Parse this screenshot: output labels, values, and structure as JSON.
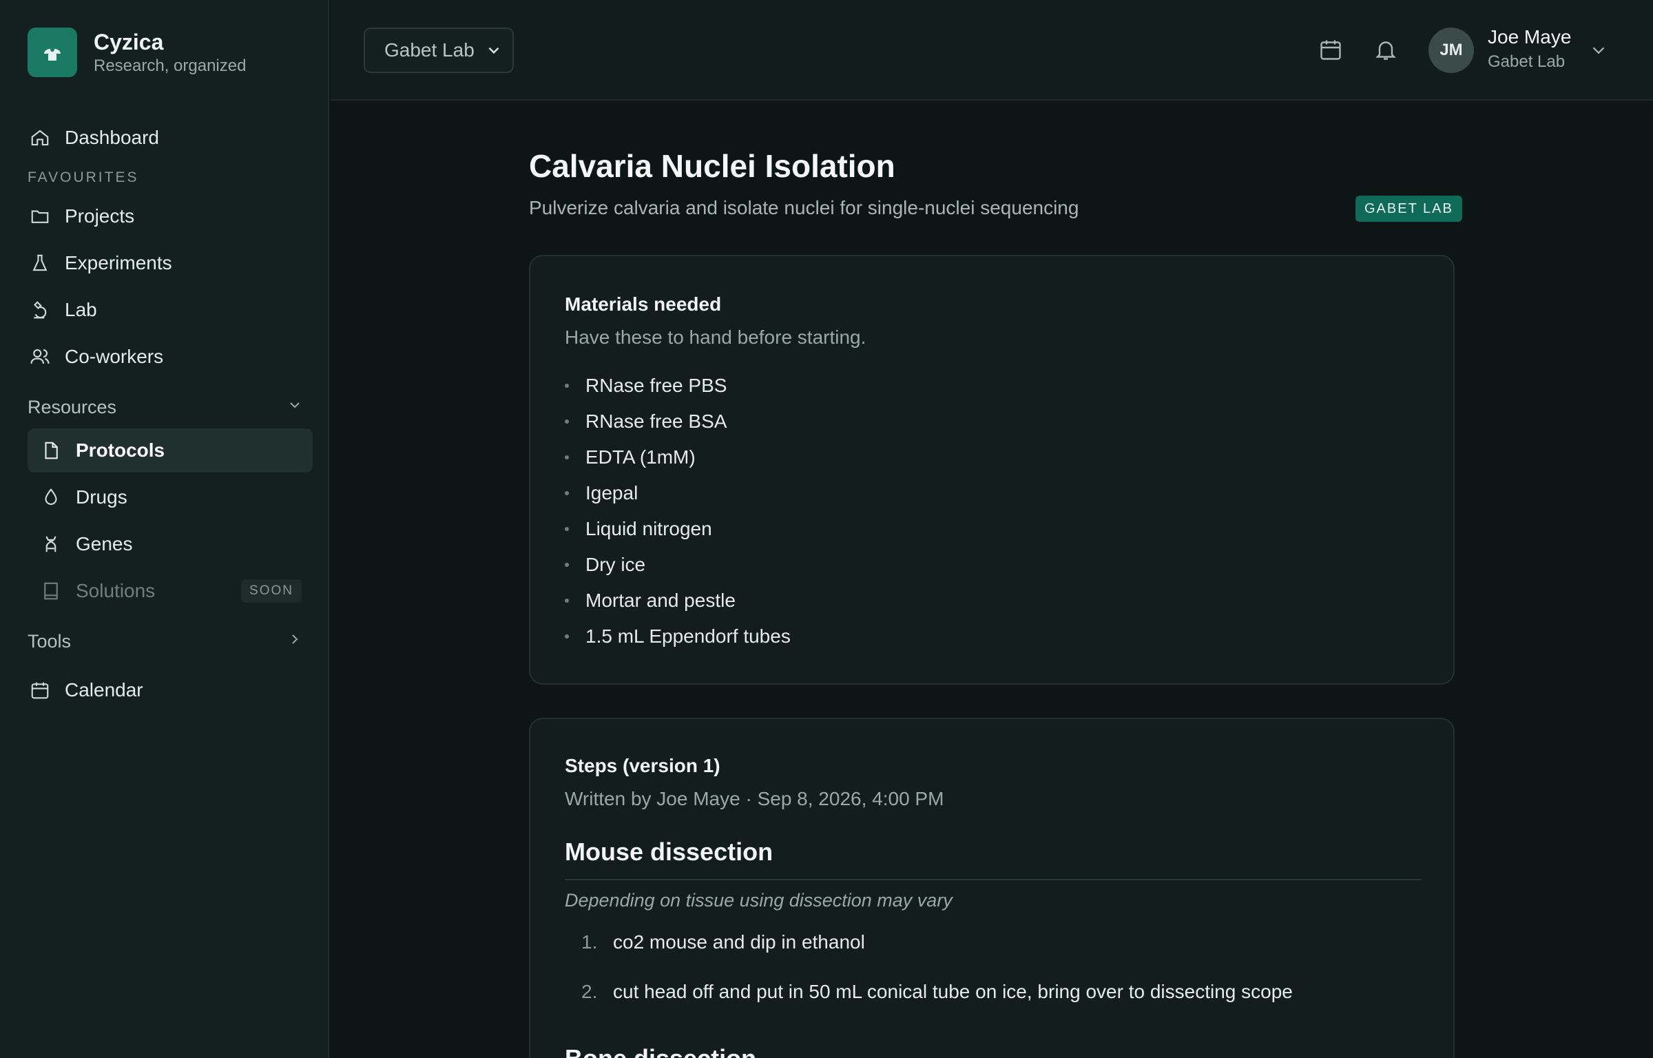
{
  "brand": {
    "name": "Cyzica",
    "tagline": "Research, organized"
  },
  "sidebar": {
    "dashboard": "Dashboard",
    "favourites_label": "FAVOURITES",
    "favourites": [
      "Projects",
      "Experiments",
      "Lab",
      "Co-workers"
    ],
    "resources_label": "Resources",
    "resources": [
      {
        "label": "Protocols"
      },
      {
        "label": "Drugs"
      },
      {
        "label": "Genes"
      },
      {
        "label": "Solutions",
        "badge": "SOON"
      }
    ],
    "tools_label": "Tools",
    "calendar": "Calendar"
  },
  "topbar": {
    "lab_select": "Gabet Lab",
    "user": {
      "initials": "JM",
      "name": "Joe Maye",
      "lab": "Gabet Lab"
    }
  },
  "protocol": {
    "title": "Calvaria Nuclei Isolation",
    "subtitle": "Pulverize calvaria and isolate nuclei for single-nuclei sequencing",
    "badge": "GABET LAB",
    "materials": {
      "title": "Materials needed",
      "subtitle": "Have these to hand before starting.",
      "items": [
        "RNase free PBS",
        "RNase free BSA",
        "EDTA (1mM)",
        "Igepal",
        "Liquid nitrogen",
        "Dry ice",
        "Mortar and pestle",
        "1.5 mL Eppendorf tubes"
      ]
    },
    "steps": {
      "title": "Steps (version 1)",
      "meta": "Written by Joe Maye · Sep 8, 2026, 4:00 PM",
      "section1": {
        "heading": "Mouse dissection",
        "note": "Depending on tissue using dissection may vary",
        "items": [
          {
            "num": "1.",
            "text": "co2 mouse and dip in ethanol"
          },
          {
            "num": "2.",
            "text": "cut head off and put in 50 mL conical tube on ice, bring over to dissecting scope"
          }
        ]
      },
      "section2": {
        "heading": "Bone dissection"
      }
    }
  },
  "colors": {
    "accent": "#1a7a64",
    "badge": "#0f6b57",
    "background": "#0d1615"
  }
}
